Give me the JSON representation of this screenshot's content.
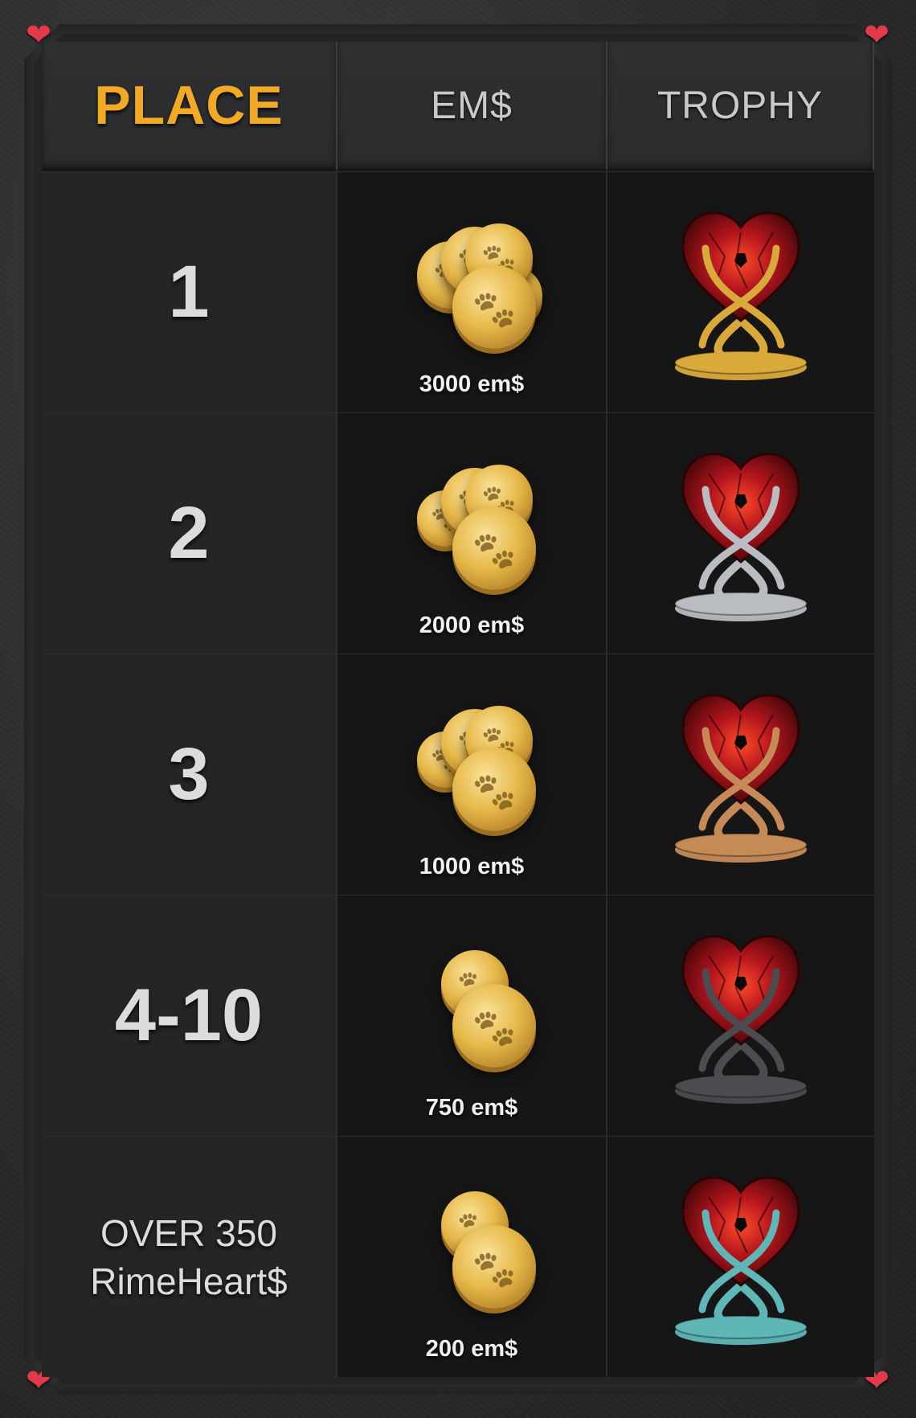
{
  "header": {
    "place": "PLACE",
    "em": "EM$",
    "trophy": "TROPHY"
  },
  "rows": [
    {
      "place_line1": "1",
      "place_line2": "",
      "reward": "3000 em$",
      "trophy_variant": "gold",
      "coin_count": 5
    },
    {
      "place_line1": "2",
      "place_line2": "",
      "reward": "2000 em$",
      "trophy_variant": "silver",
      "coin_count": 4
    },
    {
      "place_line1": "3",
      "place_line2": "",
      "reward": "1000 em$",
      "trophy_variant": "bronze",
      "coin_count": 4
    },
    {
      "place_line1": "4-10",
      "place_line2": "",
      "reward": "750 em$",
      "trophy_variant": "dark-marble",
      "coin_count": 2
    },
    {
      "place_line1": "OVER 350",
      "place_line2": "RimeHeart$",
      "reward": "200 em$",
      "trophy_variant": "teal",
      "coin_count": 2
    }
  ],
  "colors": {
    "accent": "#f2aa26",
    "gold": "#d9a93a",
    "silver": "#b9bcc0",
    "bronze": "#c68a57",
    "dark-marble": "#4a4c4f",
    "teal": "#5fb6b7",
    "heart": "#b3151d"
  },
  "icons": {
    "corner": "heart-icon",
    "coin": "paw-coin-icon",
    "trophy": "heart-trophy-icon"
  }
}
